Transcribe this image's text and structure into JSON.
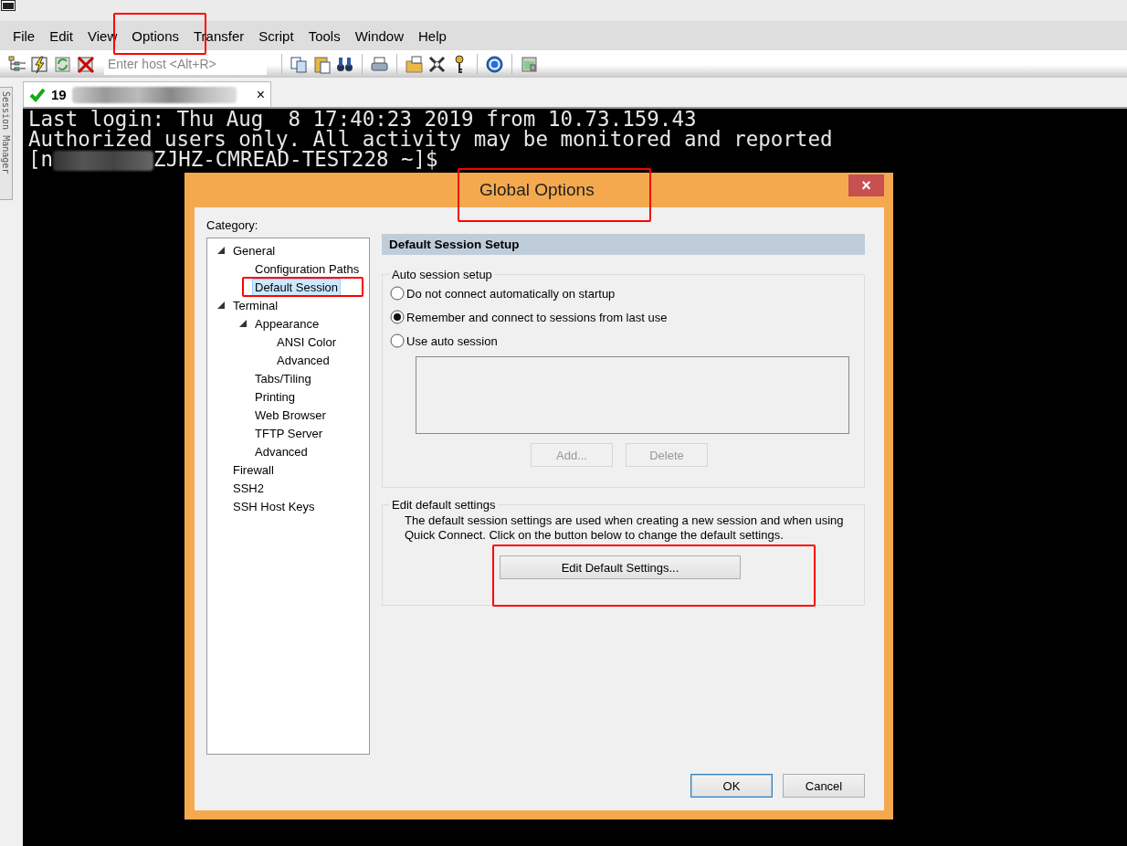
{
  "menu": [
    {
      "label": "File",
      "highlighted": false
    },
    {
      "label": "Edit",
      "highlighted": false
    },
    {
      "label": "View",
      "highlighted": false
    },
    {
      "label": "Options",
      "highlighted": true
    },
    {
      "label": "Transfer",
      "highlighted": false
    },
    {
      "label": "Script",
      "highlighted": false
    },
    {
      "label": "Tools",
      "highlighted": false
    },
    {
      "label": "Window",
      "highlighted": false
    },
    {
      "label": "Help",
      "highlighted": false
    }
  ],
  "host_field": {
    "placeholder": "Enter host <Alt+R>"
  },
  "session_manager": {
    "label": "Session Manager"
  },
  "tabs": [
    {
      "label": "19",
      "connected": true,
      "redacted": true,
      "selected": true,
      "close": "×"
    }
  ],
  "terminal": {
    "lines": [
      {
        "before": "Last login: Thu Aug  8 17:40:23 2019 from 10.73.159.43",
        "redacted": false
      },
      {
        "before": "Authorized users only. All activity may be monitored and reported",
        "redacted": false
      },
      {
        "before": "[n",
        "redacted": true,
        "after": "ZJHZ-CMREAD-TEST228 ~]$"
      }
    ]
  },
  "dialog": {
    "title": "Global Options",
    "title_highlighted": true,
    "close": "×",
    "category_label": "Category:",
    "tree": [
      {
        "label": "General",
        "expanded": true,
        "selected": false,
        "highlighted": false,
        "children": [
          {
            "label": "Configuration Paths",
            "selected": false,
            "highlighted": false
          },
          {
            "label": "Default Session",
            "selected": true,
            "highlighted": true
          }
        ]
      },
      {
        "label": "Terminal",
        "expanded": true,
        "selected": false,
        "highlighted": false,
        "children": [
          {
            "label": "Appearance",
            "expanded": true,
            "selected": false,
            "highlighted": false,
            "children": [
              {
                "label": "ANSI Color",
                "selected": false,
                "highlighted": false
              },
              {
                "label": "Advanced",
                "selected": false,
                "highlighted": false
              }
            ]
          },
          {
            "label": "Tabs/Tiling",
            "selected": false,
            "highlighted": false
          },
          {
            "label": "Printing",
            "selected": false,
            "highlighted": false
          },
          {
            "label": "Web Browser",
            "selected": false,
            "highlighted": false
          },
          {
            "label": "TFTP Server",
            "selected": false,
            "highlighted": false
          },
          {
            "label": "Advanced",
            "selected": false,
            "highlighted": false
          }
        ]
      },
      {
        "label": "Firewall",
        "selected": false,
        "highlighted": false
      },
      {
        "label": "SSH2",
        "selected": false,
        "highlighted": false
      },
      {
        "label": "SSH Host Keys",
        "selected": false,
        "highlighted": false
      }
    ],
    "panel_title": "Default Session Setup",
    "auto_group": {
      "legend": "Auto session setup",
      "options": [
        {
          "label": "Do not connect automatically on startup",
          "selected": false
        },
        {
          "label": "Remember and connect to sessions from last use",
          "selected": true
        },
        {
          "label": "Use auto session",
          "selected": false
        }
      ],
      "buttons": [
        {
          "label": "Add...",
          "disabled": true
        },
        {
          "label": "Delete",
          "disabled": true
        }
      ]
    },
    "edit_group": {
      "legend": "Edit default settings",
      "text": "The default session settings are used when creating a new session and when using Quick Connect.  Click on the button below to change the default settings.",
      "button": {
        "label": "Edit Default Settings...",
        "highlighted": true
      }
    },
    "buttons": [
      {
        "label": "OK",
        "default": true
      },
      {
        "label": "Cancel",
        "default": false
      }
    ]
  }
}
